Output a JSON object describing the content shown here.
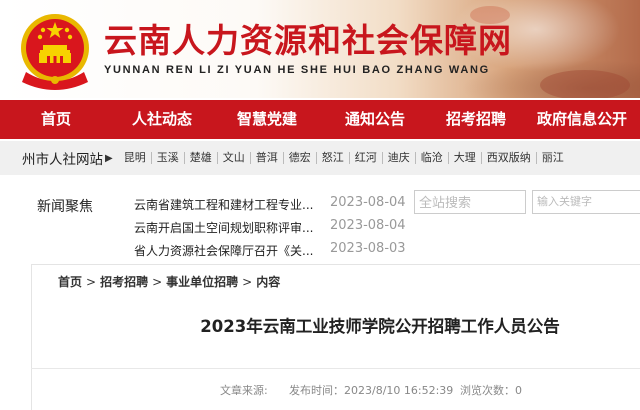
{
  "header": {
    "title": "云南人力资源和社会保障网",
    "subtitle": "YUNNAN REN LI ZI YUAN HE SHE HUI BAO ZHANG WANG",
    "emblem_icon": "national-emblem-icon"
  },
  "nav": {
    "items": [
      {
        "label": "首页"
      },
      {
        "label": "人社动态"
      },
      {
        "label": "智慧党建"
      },
      {
        "label": "通知公告"
      },
      {
        "label": "招考招聘"
      },
      {
        "label": "政府信息公开"
      }
    ]
  },
  "citybar": {
    "label": "州市人社网站",
    "arrow_icon": "triangle-right-icon",
    "cities": [
      "昆明",
      "玉溪",
      "楚雄",
      "文山",
      "普洱",
      "德宏",
      "怒江",
      "红河",
      "迪庆",
      "临沧",
      "大理",
      "西双版纳",
      "丽江"
    ]
  },
  "news": {
    "label": "新闻聚焦",
    "items": [
      {
        "title": "云南省建筑工程和建材工程专业...",
        "date": "2023-08-04"
      },
      {
        "title": "云南开启国土空间规划职称评审...",
        "date": "2023-08-04"
      },
      {
        "title": "省人力资源社会保障厅召开《关...",
        "date": "2023-08-03"
      }
    ]
  },
  "search": {
    "placeholder": "全站搜索",
    "keyword_placeholder": "输入关键字"
  },
  "breadcrumb": {
    "items": [
      "首页",
      "招考招聘",
      "事业单位招聘",
      "内容"
    ],
    "separator": ">"
  },
  "article": {
    "title": "2023年云南工业技师学院公开招聘工作人员公告",
    "source_label": "文章来源:",
    "time_label": "发布时间：2023/8/10 16:52:39",
    "views_label": "浏览次数：0"
  },
  "colors": {
    "brand_red": "#c8161d",
    "gold": "#f2c300",
    "citybar_bg": "#f0f0f0"
  }
}
